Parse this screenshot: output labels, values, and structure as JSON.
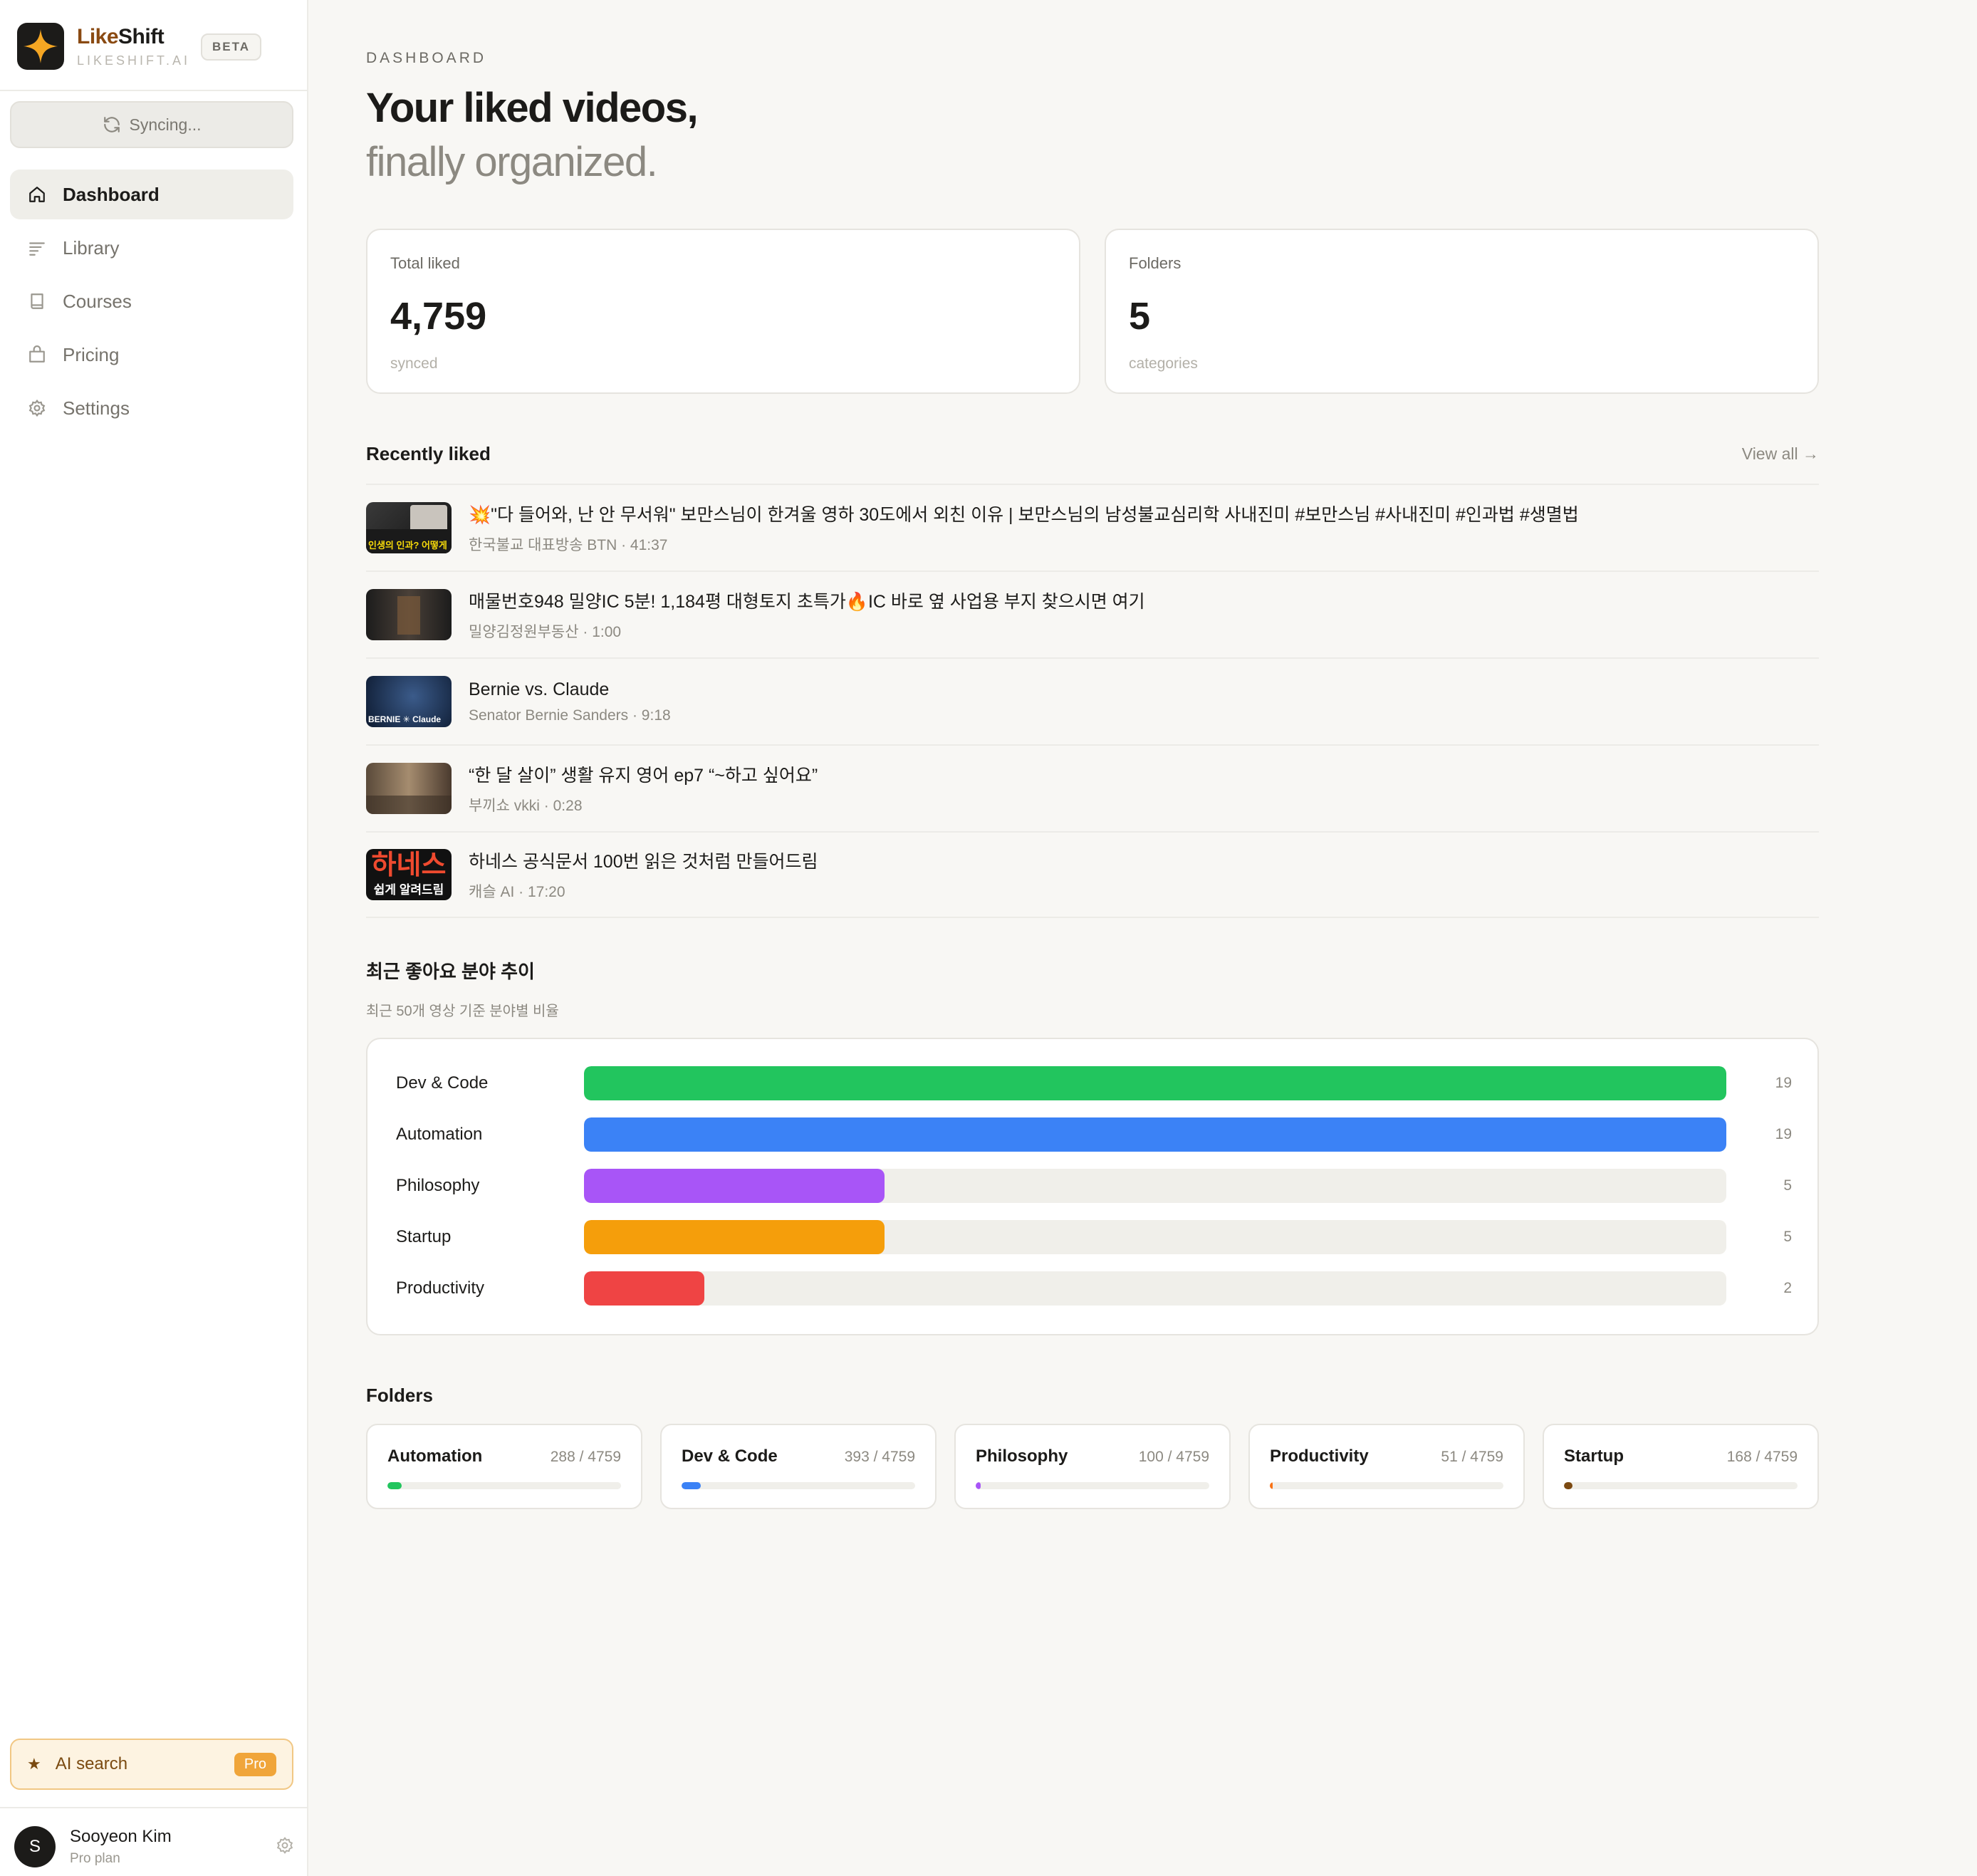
{
  "brand": {
    "name_part1": "Like",
    "name_part2": "Shift",
    "domain": "LIKESHIFT.AI",
    "badge": "BETA"
  },
  "sync": {
    "label": "Syncing..."
  },
  "nav": [
    {
      "label": "Dashboard",
      "icon": "home-icon",
      "active": true
    },
    {
      "label": "Library",
      "icon": "list-icon",
      "active": false
    },
    {
      "label": "Courses",
      "icon": "book-icon",
      "active": false
    },
    {
      "label": "Pricing",
      "icon": "bag-icon",
      "active": false
    },
    {
      "label": "Settings",
      "icon": "gear-icon",
      "active": false
    }
  ],
  "ai_search": {
    "label": "AI search",
    "badge": "Pro",
    "icon": "star-icon"
  },
  "user": {
    "initial": "S",
    "name": "Sooyeon Kim",
    "plan": "Pro plan"
  },
  "header": {
    "eyebrow": "DASHBOARD",
    "title": "Your liked videos,",
    "subtitle": "finally organized."
  },
  "stats": [
    {
      "label": "Total liked",
      "value": "4,759",
      "sub": "synced"
    },
    {
      "label": "Folders",
      "value": "5",
      "sub": "categories"
    }
  ],
  "recent": {
    "title": "Recently liked",
    "view_all": "View all →",
    "items": [
      {
        "title": "💥\"다 들어와, 난 안 무서워\" 보만스님이 한겨울 영하 30도에서 외친 이유 | 보만스님의 남성불교심리학 사내진미 #보만스님 #사내진미 #인과법 #생멸법",
        "meta": "한국불교 대표방송 BTN · 41:37",
        "thumb_text": "인생의 인과? 어떻게 알아야하나"
      },
      {
        "title": "매물번호948 밀양IC 5분! 1,184평 대형토지 초특가🔥IC 바로 옆 사업용 부지 찾으시면 여기",
        "meta": "밀양김정원부동산 · 1:00",
        "thumb_text": ""
      },
      {
        "title": "Bernie vs. Claude",
        "meta": "Senator Bernie Sanders · 9:18",
        "thumb_text": "BERNIE ✳ Claude"
      },
      {
        "title": "“한 달 살이” 생활 유지 영어 ep7 “~하고 싶어요”",
        "meta": "부끼쇼 vkki · 0:28",
        "thumb_text": ""
      },
      {
        "title": "하네스 공식문서 100번 읽은 것처럼 만들어드림",
        "meta": "캐슬 AI · 17:20",
        "thumb_text_main": "하네스",
        "thumb_text_sub": "쉽게 알려드림"
      }
    ]
  },
  "trend": {
    "title": "최근 좋아요 분야 추이",
    "subtitle": "최근 50개 영상 기준 분야별 비율"
  },
  "chart_data": {
    "type": "bar",
    "orientation": "horizontal",
    "categories": [
      "Dev & Code",
      "Automation",
      "Philosophy",
      "Startup",
      "Productivity"
    ],
    "values": [
      19,
      19,
      5,
      5,
      2
    ],
    "colors": [
      "#22c55e",
      "#3b82f6",
      "#a855f7",
      "#f59e0b",
      "#ef4444"
    ],
    "xlim": [
      0,
      19
    ]
  },
  "folders": {
    "title": "Folders",
    "items": [
      {
        "name": "Automation",
        "count": "288 / 4759",
        "fraction": 0.0605,
        "color": "#22c55e"
      },
      {
        "name": "Dev & Code",
        "count": "393 / 4759",
        "fraction": 0.0826,
        "color": "#3b82f6"
      },
      {
        "name": "Philosophy",
        "count": "100 / 4759",
        "fraction": 0.021,
        "color": "#a855f7"
      },
      {
        "name": "Productivity",
        "count": "51 / 4759",
        "fraction": 0.0107,
        "color": "#f97316"
      },
      {
        "name": "Startup",
        "count": "168 / 4759",
        "fraction": 0.0353,
        "color": "#7c4a12"
      }
    ]
  }
}
